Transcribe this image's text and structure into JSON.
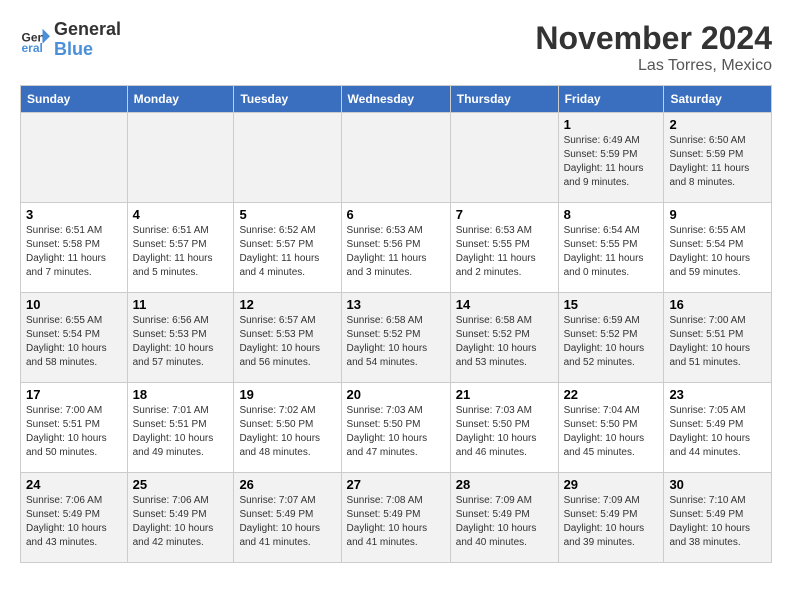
{
  "header": {
    "logo_line1": "General",
    "logo_line2": "Blue",
    "month": "November 2024",
    "location": "Las Torres, Mexico"
  },
  "columns": [
    "Sunday",
    "Monday",
    "Tuesday",
    "Wednesday",
    "Thursday",
    "Friday",
    "Saturday"
  ],
  "weeks": [
    {
      "days": [
        {
          "num": "",
          "info": ""
        },
        {
          "num": "",
          "info": ""
        },
        {
          "num": "",
          "info": ""
        },
        {
          "num": "",
          "info": ""
        },
        {
          "num": "",
          "info": ""
        },
        {
          "num": "1",
          "info": "Sunrise: 6:49 AM\nSunset: 5:59 PM\nDaylight: 11 hours and 9 minutes."
        },
        {
          "num": "2",
          "info": "Sunrise: 6:50 AM\nSunset: 5:59 PM\nDaylight: 11 hours and 8 minutes."
        }
      ]
    },
    {
      "days": [
        {
          "num": "3",
          "info": "Sunrise: 6:51 AM\nSunset: 5:58 PM\nDaylight: 11 hours and 7 minutes."
        },
        {
          "num": "4",
          "info": "Sunrise: 6:51 AM\nSunset: 5:57 PM\nDaylight: 11 hours and 5 minutes."
        },
        {
          "num": "5",
          "info": "Sunrise: 6:52 AM\nSunset: 5:57 PM\nDaylight: 11 hours and 4 minutes."
        },
        {
          "num": "6",
          "info": "Sunrise: 6:53 AM\nSunset: 5:56 PM\nDaylight: 11 hours and 3 minutes."
        },
        {
          "num": "7",
          "info": "Sunrise: 6:53 AM\nSunset: 5:55 PM\nDaylight: 11 hours and 2 minutes."
        },
        {
          "num": "8",
          "info": "Sunrise: 6:54 AM\nSunset: 5:55 PM\nDaylight: 11 hours and 0 minutes."
        },
        {
          "num": "9",
          "info": "Sunrise: 6:55 AM\nSunset: 5:54 PM\nDaylight: 10 hours and 59 minutes."
        }
      ]
    },
    {
      "days": [
        {
          "num": "10",
          "info": "Sunrise: 6:55 AM\nSunset: 5:54 PM\nDaylight: 10 hours and 58 minutes."
        },
        {
          "num": "11",
          "info": "Sunrise: 6:56 AM\nSunset: 5:53 PM\nDaylight: 10 hours and 57 minutes."
        },
        {
          "num": "12",
          "info": "Sunrise: 6:57 AM\nSunset: 5:53 PM\nDaylight: 10 hours and 56 minutes."
        },
        {
          "num": "13",
          "info": "Sunrise: 6:58 AM\nSunset: 5:52 PM\nDaylight: 10 hours and 54 minutes."
        },
        {
          "num": "14",
          "info": "Sunrise: 6:58 AM\nSunset: 5:52 PM\nDaylight: 10 hours and 53 minutes."
        },
        {
          "num": "15",
          "info": "Sunrise: 6:59 AM\nSunset: 5:52 PM\nDaylight: 10 hours and 52 minutes."
        },
        {
          "num": "16",
          "info": "Sunrise: 7:00 AM\nSunset: 5:51 PM\nDaylight: 10 hours and 51 minutes."
        }
      ]
    },
    {
      "days": [
        {
          "num": "17",
          "info": "Sunrise: 7:00 AM\nSunset: 5:51 PM\nDaylight: 10 hours and 50 minutes."
        },
        {
          "num": "18",
          "info": "Sunrise: 7:01 AM\nSunset: 5:51 PM\nDaylight: 10 hours and 49 minutes."
        },
        {
          "num": "19",
          "info": "Sunrise: 7:02 AM\nSunset: 5:50 PM\nDaylight: 10 hours and 48 minutes."
        },
        {
          "num": "20",
          "info": "Sunrise: 7:03 AM\nSunset: 5:50 PM\nDaylight: 10 hours and 47 minutes."
        },
        {
          "num": "21",
          "info": "Sunrise: 7:03 AM\nSunset: 5:50 PM\nDaylight: 10 hours and 46 minutes."
        },
        {
          "num": "22",
          "info": "Sunrise: 7:04 AM\nSunset: 5:50 PM\nDaylight: 10 hours and 45 minutes."
        },
        {
          "num": "23",
          "info": "Sunrise: 7:05 AM\nSunset: 5:49 PM\nDaylight: 10 hours and 44 minutes."
        }
      ]
    },
    {
      "days": [
        {
          "num": "24",
          "info": "Sunrise: 7:06 AM\nSunset: 5:49 PM\nDaylight: 10 hours and 43 minutes."
        },
        {
          "num": "25",
          "info": "Sunrise: 7:06 AM\nSunset: 5:49 PM\nDaylight: 10 hours and 42 minutes."
        },
        {
          "num": "26",
          "info": "Sunrise: 7:07 AM\nSunset: 5:49 PM\nDaylight: 10 hours and 41 minutes."
        },
        {
          "num": "27",
          "info": "Sunrise: 7:08 AM\nSunset: 5:49 PM\nDaylight: 10 hours and 41 minutes."
        },
        {
          "num": "28",
          "info": "Sunrise: 7:09 AM\nSunset: 5:49 PM\nDaylight: 10 hours and 40 minutes."
        },
        {
          "num": "29",
          "info": "Sunrise: 7:09 AM\nSunset: 5:49 PM\nDaylight: 10 hours and 39 minutes."
        },
        {
          "num": "30",
          "info": "Sunrise: 7:10 AM\nSunset: 5:49 PM\nDaylight: 10 hours and 38 minutes."
        }
      ]
    }
  ]
}
